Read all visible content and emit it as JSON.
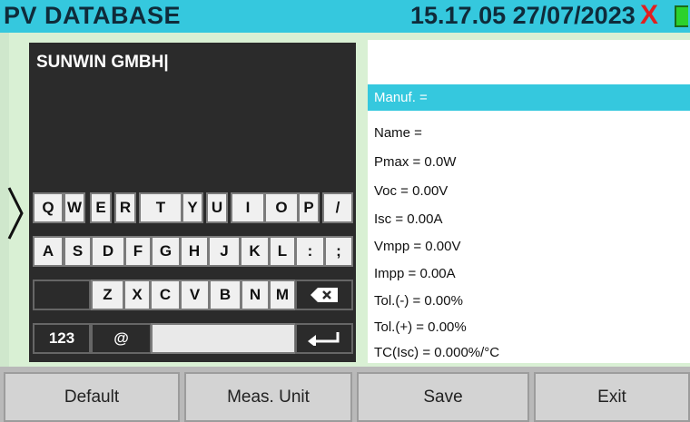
{
  "header": {
    "title": "PV DATABASE",
    "datetime": "15.17.05 27/07/2023",
    "close_glyph": "X"
  },
  "entry": {
    "text": "SUNWIN GMBH|"
  },
  "keyboard": {
    "row1": [
      "Q",
      "W",
      "E",
      "R",
      "T",
      "Y",
      "U",
      "I",
      "O",
      "P",
      "/"
    ],
    "row2": [
      "A",
      "S",
      "D",
      "F",
      "G",
      "H",
      "J",
      "K",
      "L",
      ":",
      ";"
    ],
    "row3": [
      "Z",
      "X",
      "C",
      "V",
      "B",
      "N",
      "M"
    ],
    "row4": {
      "numbers": "123",
      "at": "@"
    },
    "backspace_icon": "backspace-icon",
    "enter_icon": "enter-icon"
  },
  "info": {
    "manuf": "Manuf. =",
    "name": "Name  =",
    "pmax": "Pmax =  0.0W",
    "voc": "Voc =  0.00V",
    "isc": "Isc =  0.00A",
    "vmpp": "Vmpp = 0.00V",
    "impp": "Impp = 0.00A",
    "tol_minus": "Tol.(-) =  0.00%",
    "tol_plus": "Tol.(+) =  0.00%",
    "tc_isc": "TC(Isc) =  0.000%/°C"
  },
  "footer": {
    "default": "Default",
    "meas_unit": "Meas. Unit",
    "save": "Save",
    "exit": "Exit"
  },
  "colors": {
    "accent": "#35c8de",
    "panel_bg": "#d9f0d4",
    "close": "#e02020",
    "battery": "#2cd12c"
  }
}
